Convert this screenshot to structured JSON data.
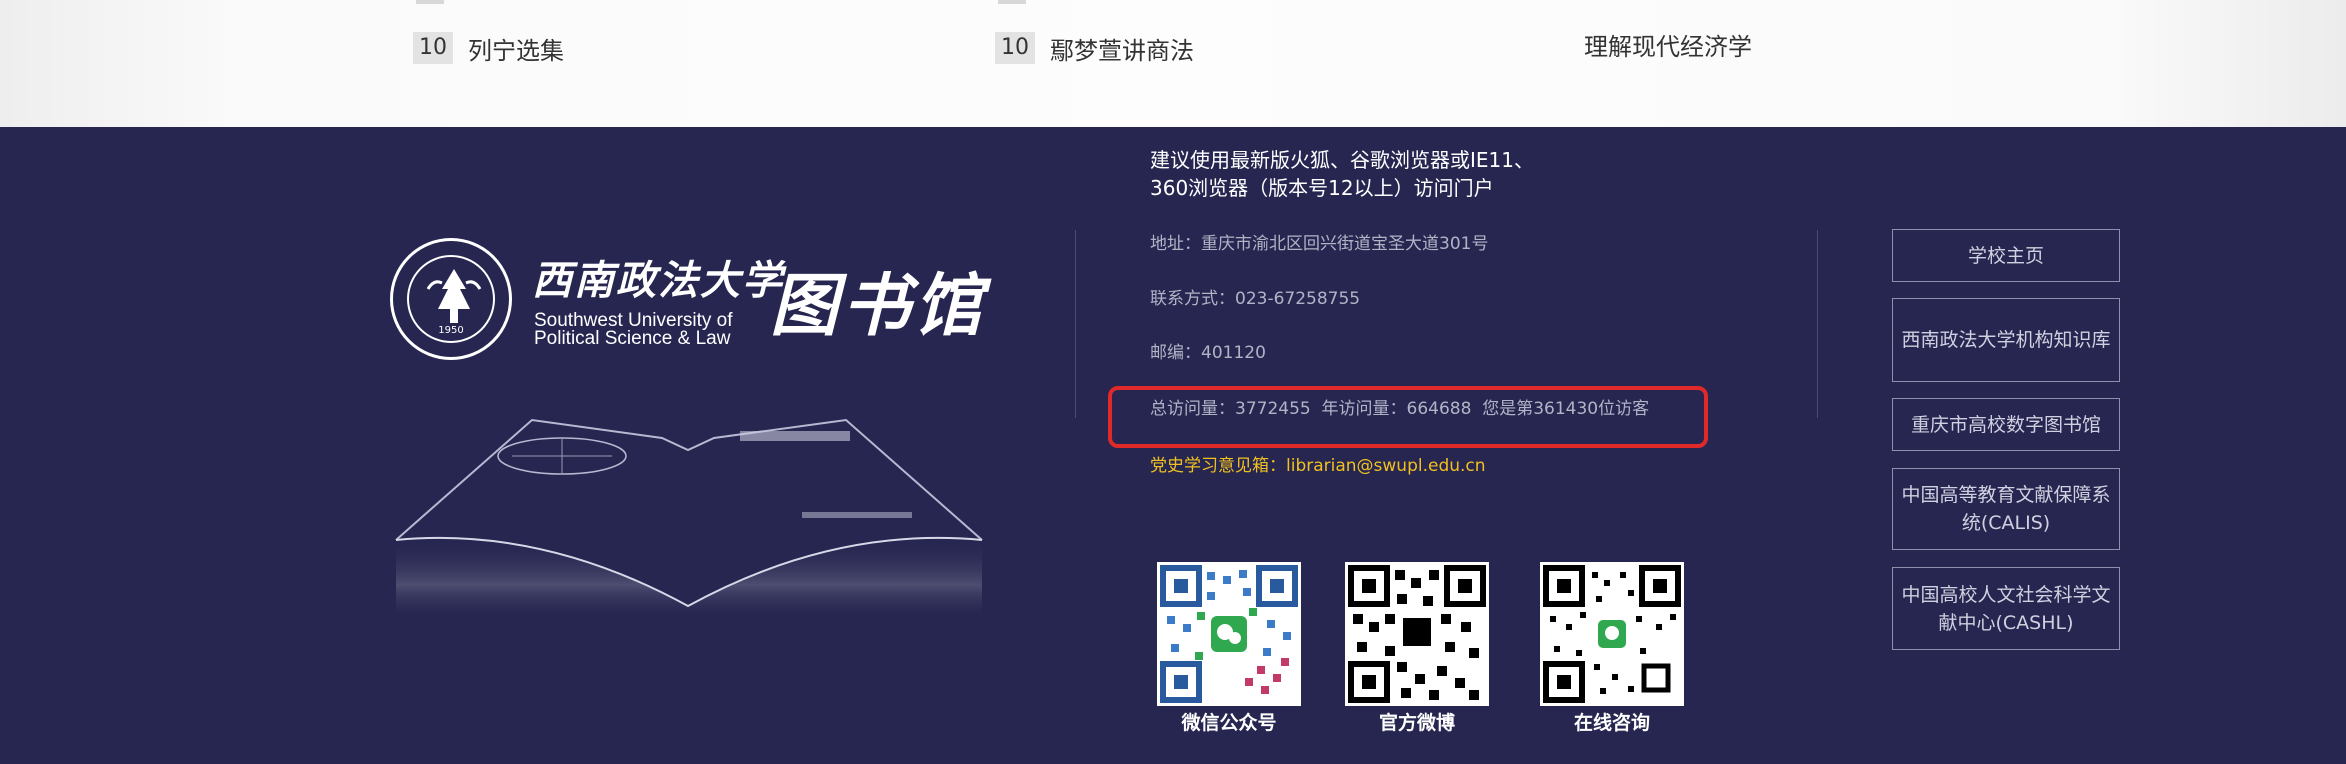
{
  "ranking": {
    "items": [
      {
        "rank": "10",
        "title": "列宁选集"
      },
      {
        "rank": "10",
        "title": "鄢梦萱讲商法"
      },
      {
        "rank": "",
        "title": "理解现代经济学"
      }
    ]
  },
  "logo": {
    "univ_cn": "西南政法大学",
    "univ_en_line1": "Southwest University of",
    "univ_en_line2": "Political Science & Law",
    "library_cn": "图书馆",
    "emblem_year": "1950"
  },
  "info": {
    "browser_notice_line1": "建议使用最新版火狐、谷歌浏览器或IE11、",
    "browser_notice_line2": "360浏览器（版本号12以上）访问门户",
    "address": "地址：重庆市渝北区回兴街道宝圣大道301号",
    "contact": "联系方式：023-67258755",
    "postcode": "邮编：401120",
    "visits": "总访问量：3772455  年访问量：664688  您是第361430位访客",
    "mailbox": "党史学习意见箱：librarian@swupl.edu.cn"
  },
  "qrcodes": [
    {
      "label": "微信公众号",
      "icon": "wechat-qr-icon"
    },
    {
      "label": "官方微博",
      "icon": "weibo-qr-icon"
    },
    {
      "label": "在线咨询",
      "icon": "consult-qr-icon"
    }
  ],
  "links": [
    {
      "label": "学校主页"
    },
    {
      "label": "西南政法大学机构知识库"
    },
    {
      "label": "重庆市高校数字图书馆"
    },
    {
      "label": "中国高等教育文献保障系统(CALIS)"
    },
    {
      "label": "中国高校人文社会科学文献中心(CASHL)"
    }
  ],
  "colors": {
    "footer_bg": "#262651",
    "highlight": "#e02a2a",
    "mailbox": "#f0c020"
  }
}
